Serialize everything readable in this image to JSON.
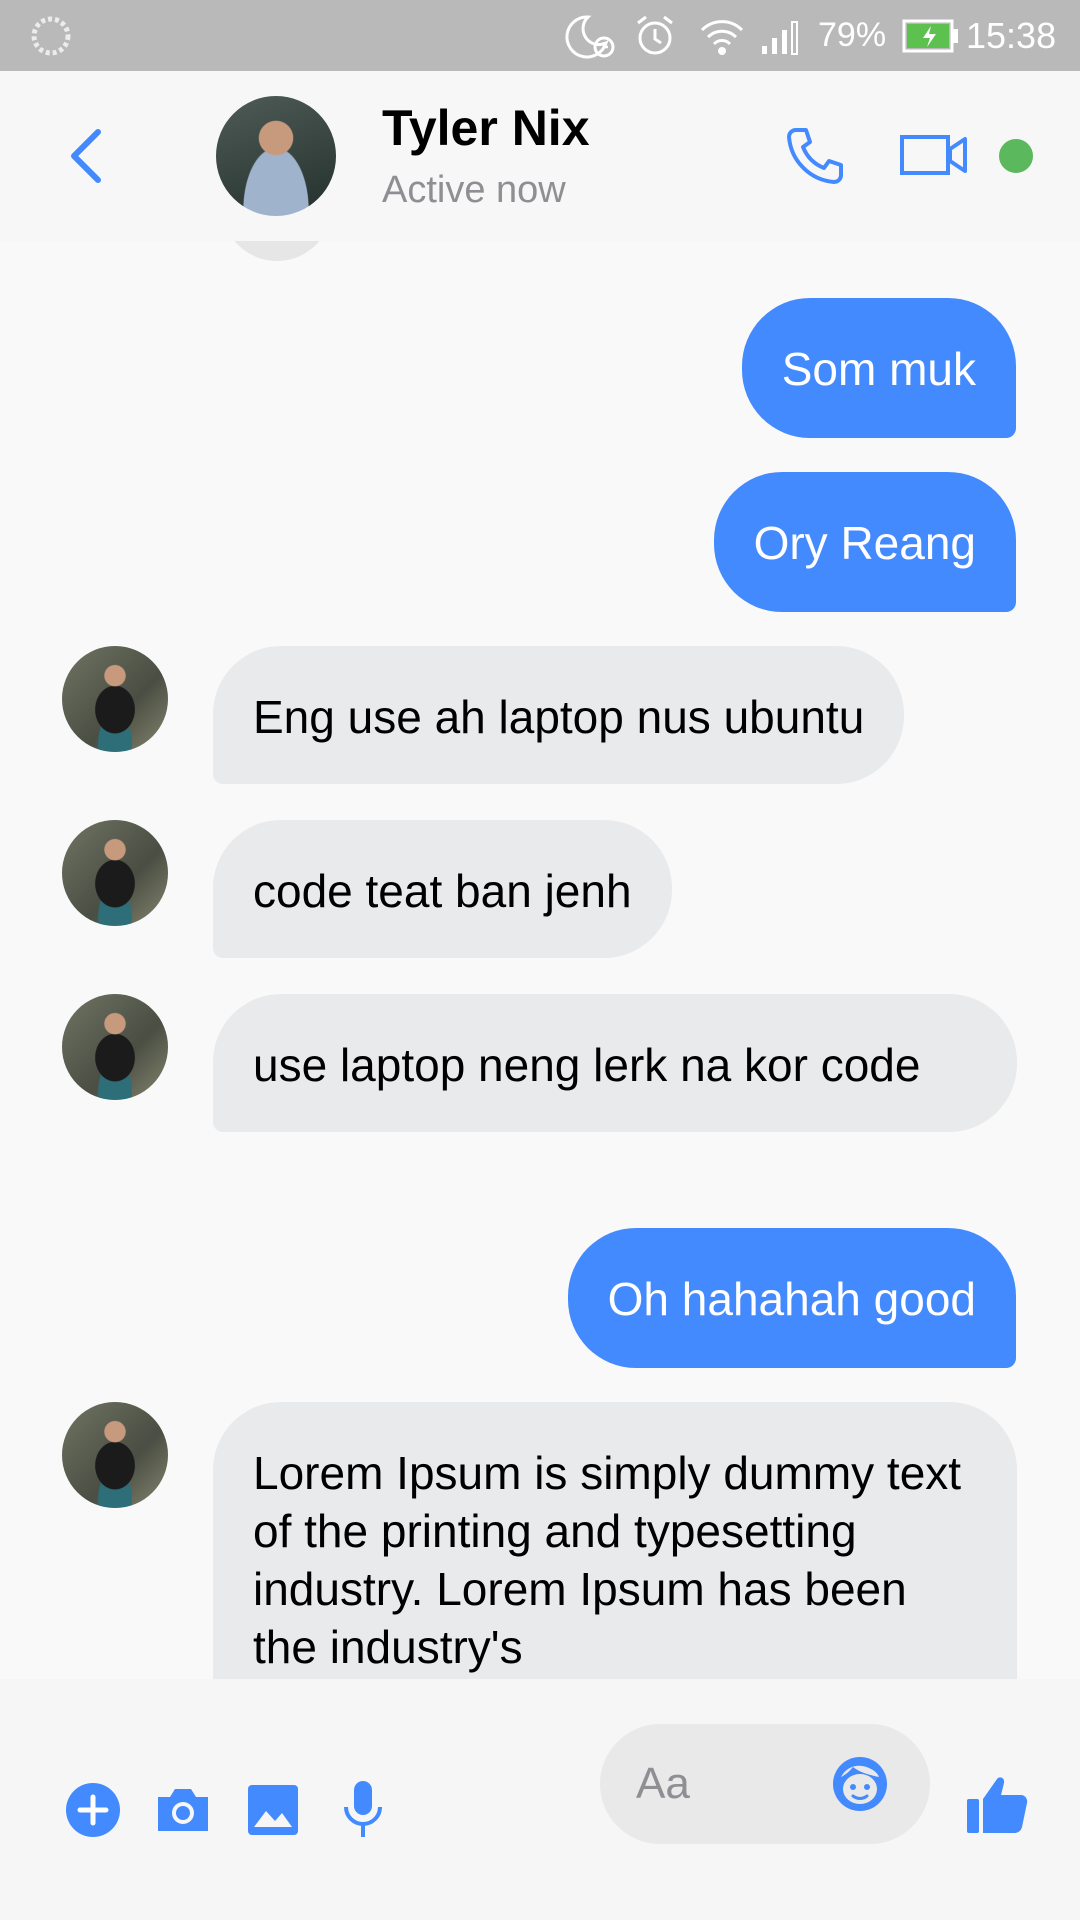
{
  "status_bar": {
    "battery_percent": "79%",
    "time": "15:38"
  },
  "header": {
    "contact_name": "Tyler Nix",
    "contact_status": "Active now"
  },
  "messages": [
    {
      "side": "out",
      "text": "Som muk"
    },
    {
      "side": "out",
      "text": "Ory Reang"
    },
    {
      "side": "in",
      "text": "Eng use ah laptop nus ubuntu"
    },
    {
      "side": "in",
      "text": "code teat ban jenh"
    },
    {
      "side": "in",
      "text": "use laptop neng lerk na kor code"
    },
    {
      "side": "out",
      "text": "Oh hahahah good"
    },
    {
      "side": "in",
      "text": "Lorem Ipsum is simply dummy text of the printing and typesetting industry. Lorem Ipsum has been the industry's"
    }
  ],
  "composer": {
    "placeholder": "Aa"
  },
  "colors": {
    "accent": "#448aff",
    "online": "#5cb85c",
    "incoming_bubble": "#e9eaec"
  }
}
